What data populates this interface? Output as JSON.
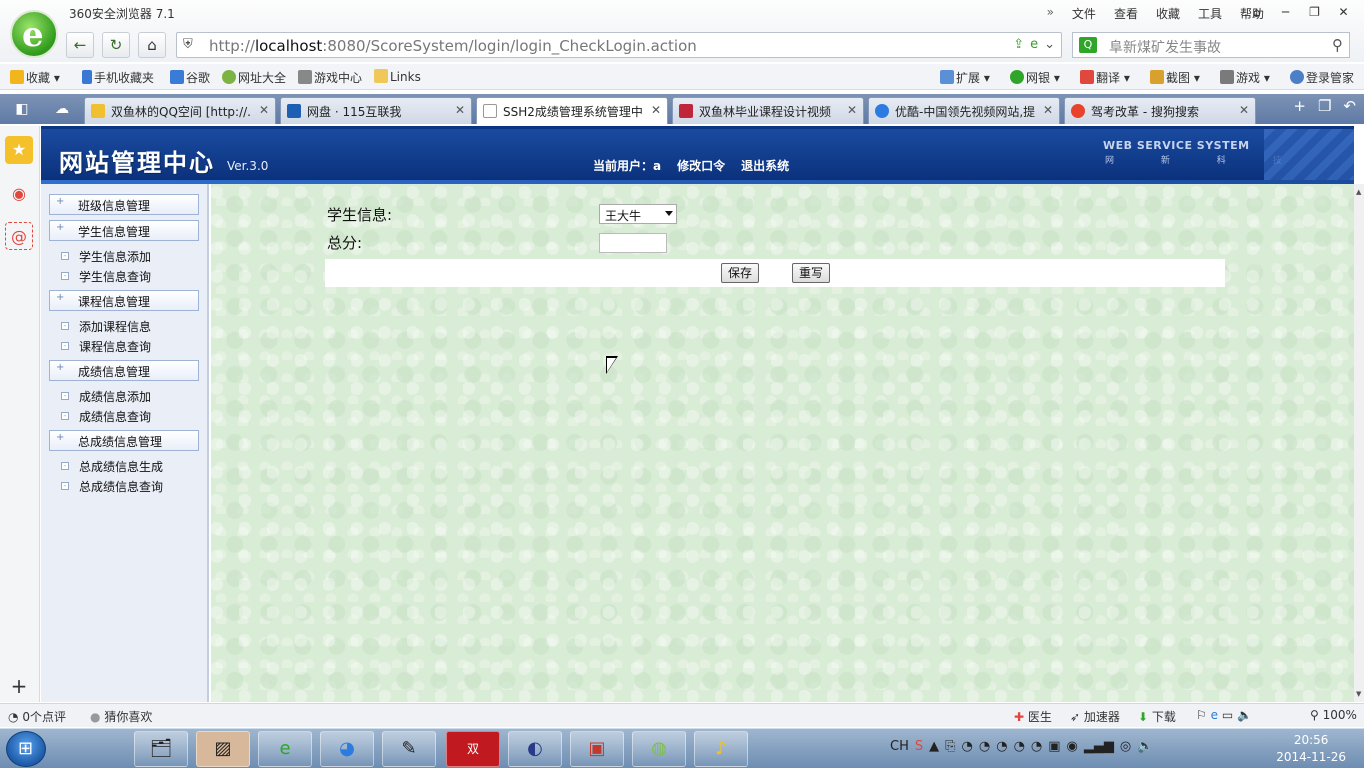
{
  "browser": {
    "app_title": "360安全浏览器 7.1",
    "menu": [
      "文件",
      "查看",
      "收藏",
      "工具",
      "帮助"
    ],
    "menu_chevron": "»",
    "win_controls": [
      "shirt-icon",
      "minimize-icon",
      "restore-icon",
      "close-icon"
    ],
    "url_prefix": "http://",
    "url_host": "localhost",
    "url_rest": ":8080/ScoreSystem/login/login_CheckLogin.action",
    "search_placeholder": "阜新煤矿发生事故",
    "bookmarks": [
      "收藏",
      "手机收藏夹",
      "谷歌",
      "网址大全",
      "游戏中心",
      "Links"
    ],
    "bookmarks_right": [
      "扩展",
      "网银",
      "翻译",
      "截图",
      "游戏",
      "登录管家"
    ],
    "tabs": [
      {
        "label": "双鱼林的QQ空间 [http://.",
        "color": "#f0c030"
      },
      {
        "label": "网盘 · 115互联我",
        "color": "#1d5fb3"
      },
      {
        "label": "SSH2成绩管理系统管理中",
        "color": "#ffffff",
        "active": true
      },
      {
        "label": "双鱼林毕业课程设计视频",
        "color": "#c0263a"
      },
      {
        "label": "优酷-中国领先视频网站,提",
        "color": "#2b7be0"
      },
      {
        "label": "驾考改革 - 搜狗搜索",
        "color": "#e8412c"
      }
    ]
  },
  "header": {
    "title": "网站管理中心",
    "version": "Ver.3.0",
    "current_user_label": "当前用户：",
    "current_user": "a",
    "change_password": "修改口令",
    "logout": "退出系统",
    "brand_line1": "WEB SERVICE SYSTEM",
    "brand_line2": "网 新 科 技"
  },
  "leftnav": {
    "groups": [
      {
        "label": "班级信息管理",
        "items": []
      },
      {
        "label": "学生信息管理",
        "items": [
          "学生信息添加",
          "学生信息查询"
        ]
      },
      {
        "label": "课程信息管理",
        "items": [
          "添加课程信息",
          "课程信息查询"
        ]
      },
      {
        "label": "成绩信息管理",
        "items": [
          "成绩信息添加",
          "成绩信息查询"
        ]
      },
      {
        "label": "总成绩信息管理",
        "items": [
          "总成绩信息生成",
          "总成绩信息查询"
        ]
      }
    ]
  },
  "form": {
    "student_label": "学生信息:",
    "student_value": "王大牛",
    "total_label": "总分:",
    "total_value": "",
    "save_label": "保存",
    "reset_label": "重写"
  },
  "statusbar": {
    "left": [
      "0个点评",
      "猜你喜欢"
    ],
    "right": [
      "医生",
      "加速器",
      "下载",
      "100%"
    ]
  },
  "taskbar": {
    "ime": "CH",
    "time": "20:56",
    "date": "2014-11-26"
  }
}
